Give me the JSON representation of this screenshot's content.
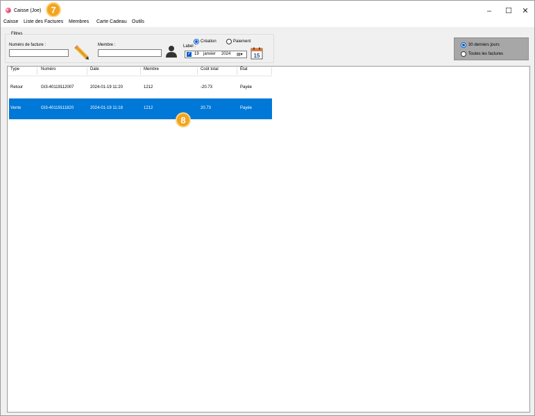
{
  "window": {
    "title": "Caisse (Joe)",
    "controls": {
      "minimize": "–",
      "maximize": "☐",
      "close": "✕"
    }
  },
  "menu": [
    "Caisse",
    "Liste des Factures",
    "Membres",
    "Carte Cadeau",
    "Outils"
  ],
  "badges": {
    "menu_step": "7",
    "row_step": "8"
  },
  "filters": {
    "legend": "Filtres",
    "invoice_label": "Numéro de facture :",
    "invoice_value": "",
    "member_label": "Membre :",
    "member_value": "",
    "date_type": {
      "creation": "Création",
      "payment": "Paiement",
      "selected": "Création"
    },
    "label_text": "Label :",
    "date": {
      "checked": true,
      "day": "19",
      "month": "janvier",
      "year": "2024"
    },
    "calendar_number": "15"
  },
  "range": {
    "options": [
      "30 derniers jours",
      "Toutes les factures"
    ],
    "selected": "30 derniers jours"
  },
  "table": {
    "columns": [
      "Type",
      "Numéro",
      "Date",
      "Membre",
      "Coût total",
      "État"
    ],
    "rows": [
      {
        "type": "Retour",
        "numero": "GI3-40119112007",
        "date": "2024-01-19 11:20",
        "membre": "1212",
        "cout": "-20.73",
        "etat": "Payée",
        "selected": false
      },
      {
        "type": "Vente",
        "numero": "GI3-40119111820",
        "date": "2024-01-19 11:18",
        "membre": "1212",
        "cout": "20.73",
        "etat": "Payée",
        "selected": true
      }
    ]
  },
  "colors": {
    "selection": "#0078d7",
    "badge": "#f2a51e",
    "accent": "#0a5fc7"
  }
}
